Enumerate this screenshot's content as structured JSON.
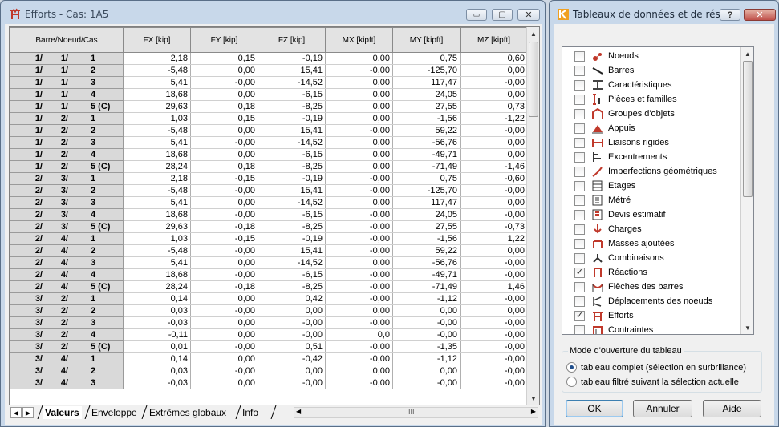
{
  "efforts_window": {
    "title": "Efforts - Cas: 1A5",
    "minimize_glyph": "▭",
    "maximize_glyph": "▢",
    "close_glyph": "✕",
    "columns": [
      "Barre/Noeud/Cas",
      "FX [kip]",
      "FY [kip]",
      "FZ [kip]",
      "MX [kipft]",
      "MY [kipft]",
      "MZ [kipft]"
    ],
    "rows": [
      {
        "b": "1/",
        "n": "1/",
        "c": "1",
        "v": [
          "2,18",
          "0,15",
          "-0,19",
          "0,00",
          "0,75",
          "0,60"
        ]
      },
      {
        "b": "1/",
        "n": "1/",
        "c": "2",
        "v": [
          "-5,48",
          "0,00",
          "15,41",
          "-0,00",
          "-125,70",
          "0,00"
        ]
      },
      {
        "b": "1/",
        "n": "1/",
        "c": "3",
        "v": [
          "5,41",
          "-0,00",
          "-14,52",
          "0,00",
          "117,47",
          "-0,00"
        ]
      },
      {
        "b": "1/",
        "n": "1/",
        "c": "4",
        "v": [
          "18,68",
          "0,00",
          "-6,15",
          "0,00",
          "24,05",
          "0,00"
        ]
      },
      {
        "b": "1/",
        "n": "1/",
        "c": "5 (C)",
        "v": [
          "29,63",
          "0,18",
          "-8,25",
          "0,00",
          "27,55",
          "0,73"
        ]
      },
      {
        "b": "1/",
        "n": "2/",
        "c": "1",
        "v": [
          "1,03",
          "0,15",
          "-0,19",
          "0,00",
          "-1,56",
          "-1,22"
        ]
      },
      {
        "b": "1/",
        "n": "2/",
        "c": "2",
        "v": [
          "-5,48",
          "0,00",
          "15,41",
          "-0,00",
          "59,22",
          "-0,00"
        ]
      },
      {
        "b": "1/",
        "n": "2/",
        "c": "3",
        "v": [
          "5,41",
          "-0,00",
          "-14,52",
          "0,00",
          "-56,76",
          "0,00"
        ]
      },
      {
        "b": "1/",
        "n": "2/",
        "c": "4",
        "v": [
          "18,68",
          "0,00",
          "-6,15",
          "0,00",
          "-49,71",
          "0,00"
        ]
      },
      {
        "b": "1/",
        "n": "2/",
        "c": "5 (C)",
        "v": [
          "28,24",
          "0,18",
          "-8,25",
          "0,00",
          "-71,49",
          "-1,46"
        ]
      },
      {
        "b": "2/",
        "n": "3/",
        "c": "1",
        "v": [
          "2,18",
          "-0,15",
          "-0,19",
          "-0,00",
          "0,75",
          "-0,60"
        ]
      },
      {
        "b": "2/",
        "n": "3/",
        "c": "2",
        "v": [
          "-5,48",
          "-0,00",
          "15,41",
          "-0,00",
          "-125,70",
          "-0,00"
        ]
      },
      {
        "b": "2/",
        "n": "3/",
        "c": "3",
        "v": [
          "5,41",
          "0,00",
          "-14,52",
          "0,00",
          "117,47",
          "0,00"
        ]
      },
      {
        "b": "2/",
        "n": "3/",
        "c": "4",
        "v": [
          "18,68",
          "-0,00",
          "-6,15",
          "-0,00",
          "24,05",
          "-0,00"
        ]
      },
      {
        "b": "2/",
        "n": "3/",
        "c": "5 (C)",
        "v": [
          "29,63",
          "-0,18",
          "-8,25",
          "-0,00",
          "27,55",
          "-0,73"
        ]
      },
      {
        "b": "2/",
        "n": "4/",
        "c": "1",
        "v": [
          "1,03",
          "-0,15",
          "-0,19",
          "-0,00",
          "-1,56",
          "1,22"
        ]
      },
      {
        "b": "2/",
        "n": "4/",
        "c": "2",
        "v": [
          "-5,48",
          "-0,00",
          "15,41",
          "-0,00",
          "59,22",
          "0,00"
        ]
      },
      {
        "b": "2/",
        "n": "4/",
        "c": "3",
        "v": [
          "5,41",
          "0,00",
          "-14,52",
          "0,00",
          "-56,76",
          "-0,00"
        ]
      },
      {
        "b": "2/",
        "n": "4/",
        "c": "4",
        "v": [
          "18,68",
          "-0,00",
          "-6,15",
          "-0,00",
          "-49,71",
          "-0,00"
        ]
      },
      {
        "b": "2/",
        "n": "4/",
        "c": "5 (C)",
        "v": [
          "28,24",
          "-0,18",
          "-8,25",
          "-0,00",
          "-71,49",
          "1,46"
        ]
      },
      {
        "b": "3/",
        "n": "2/",
        "c": "1",
        "v": [
          "0,14",
          "0,00",
          "0,42",
          "-0,00",
          "-1,12",
          "-0,00"
        ]
      },
      {
        "b": "3/",
        "n": "2/",
        "c": "2",
        "v": [
          "0,03",
          "-0,00",
          "0,00",
          "0,00",
          "0,00",
          "0,00"
        ]
      },
      {
        "b": "3/",
        "n": "2/",
        "c": "3",
        "v": [
          "-0,03",
          "0,00",
          "-0,00",
          "-0,00",
          "-0,00",
          "-0,00"
        ]
      },
      {
        "b": "3/",
        "n": "2/",
        "c": "4",
        "v": [
          "-0,11",
          "0,00",
          "-0,00",
          "0,0",
          "-0,00",
          "-0,00"
        ]
      },
      {
        "b": "3/",
        "n": "2/",
        "c": "5 (C)",
        "v": [
          "0,01",
          "-0,00",
          "0,51",
          "-0,00",
          "-1,35",
          "-0,00"
        ]
      },
      {
        "b": "3/",
        "n": "4/",
        "c": "1",
        "v": [
          "0,14",
          "0,00",
          "-0,42",
          "-0,00",
          "-1,12",
          "-0,00"
        ]
      },
      {
        "b": "3/",
        "n": "4/",
        "c": "2",
        "v": [
          "0,03",
          "-0,00",
          "0,00",
          "0,00",
          "0,00",
          "-0,00"
        ]
      },
      {
        "b": "3/",
        "n": "4/",
        "c": "3",
        "v": [
          "-0,03",
          "0,00",
          "-0,00",
          "-0,00",
          "-0,00",
          "-0,00"
        ]
      }
    ],
    "tabs": [
      {
        "label": "Valeurs",
        "active": true
      },
      {
        "label": "Enveloppe",
        "active": false
      },
      {
        "label": "Extrêmes globaux",
        "active": false
      },
      {
        "label": "Info",
        "active": false
      }
    ],
    "hscroll_grip": "III"
  },
  "tables_dialog": {
    "title": "Tableaux de données et de résul...",
    "help_glyph": "?",
    "close_glyph": "✕",
    "items": [
      {
        "label": "Noeuds",
        "checked": false,
        "icon": "nodes-icon",
        "color": "#c0392b"
      },
      {
        "label": "Barres",
        "checked": false,
        "icon": "bars-icon",
        "color": "#222222"
      },
      {
        "label": "Caractéristiques",
        "checked": false,
        "icon": "section-properties-icon",
        "color": "#444444"
      },
      {
        "label": "Pièces et familles",
        "checked": false,
        "icon": "members-families-icon",
        "color": "#c0392b"
      },
      {
        "label": "Groupes d'objets",
        "checked": false,
        "icon": "object-groups-icon",
        "color": "#c0392b"
      },
      {
        "label": "Appuis",
        "checked": false,
        "icon": "supports-icon",
        "color": "#c0392b"
      },
      {
        "label": "Liaisons rigides",
        "checked": false,
        "icon": "rigid-links-icon",
        "color": "#c0392b"
      },
      {
        "label": "Excentrements",
        "checked": false,
        "icon": "offsets-icon",
        "color": "#333333"
      },
      {
        "label": "Imperfections géométriques",
        "checked": false,
        "icon": "imperfections-icon",
        "color": "#c0392b"
      },
      {
        "label": "Etages",
        "checked": false,
        "icon": "storeys-icon",
        "color": "#333333"
      },
      {
        "label": "Métré",
        "checked": false,
        "icon": "takeoff-icon",
        "color": "#333333"
      },
      {
        "label": "Devis estimatif",
        "checked": false,
        "icon": "estimate-icon",
        "color": "#c0392b"
      },
      {
        "label": "Charges",
        "checked": false,
        "icon": "loads-icon",
        "color": "#c0392b"
      },
      {
        "label": "Masses ajoutées",
        "checked": false,
        "icon": "added-masses-icon",
        "color": "#c0392b"
      },
      {
        "label": "Combinaisons",
        "checked": false,
        "icon": "combinations-icon",
        "color": "#333333"
      },
      {
        "label": "Réactions",
        "checked": true,
        "icon": "reactions-icon",
        "color": "#c0392b"
      },
      {
        "label": "Flèches des barres",
        "checked": false,
        "icon": "deflections-icon",
        "color": "#c0392b"
      },
      {
        "label": "Déplacements des noeuds",
        "checked": false,
        "icon": "displacements-icon",
        "color": "#333333"
      },
      {
        "label": "Efforts",
        "checked": true,
        "icon": "forces-icon",
        "color": "#c0392b"
      },
      {
        "label": "Contraintes",
        "checked": false,
        "icon": "stresses-icon",
        "color": "#c0392b"
      }
    ],
    "check_glyph": "✓",
    "open_mode_title": "Mode d'ouverture du tableau",
    "open_mode_options": [
      {
        "label": "tableau complet (sélection en surbrillance)",
        "selected": true
      },
      {
        "label": "tableau filtré suivant la sélection actuelle",
        "selected": false
      }
    ],
    "ok_label": "OK",
    "cancel_label": "Annuler",
    "help_label": "Aide"
  },
  "colors": {
    "accent": "#c0392b",
    "window_frame": "#c8d8ea",
    "row_header": "#d9d9d9"
  }
}
